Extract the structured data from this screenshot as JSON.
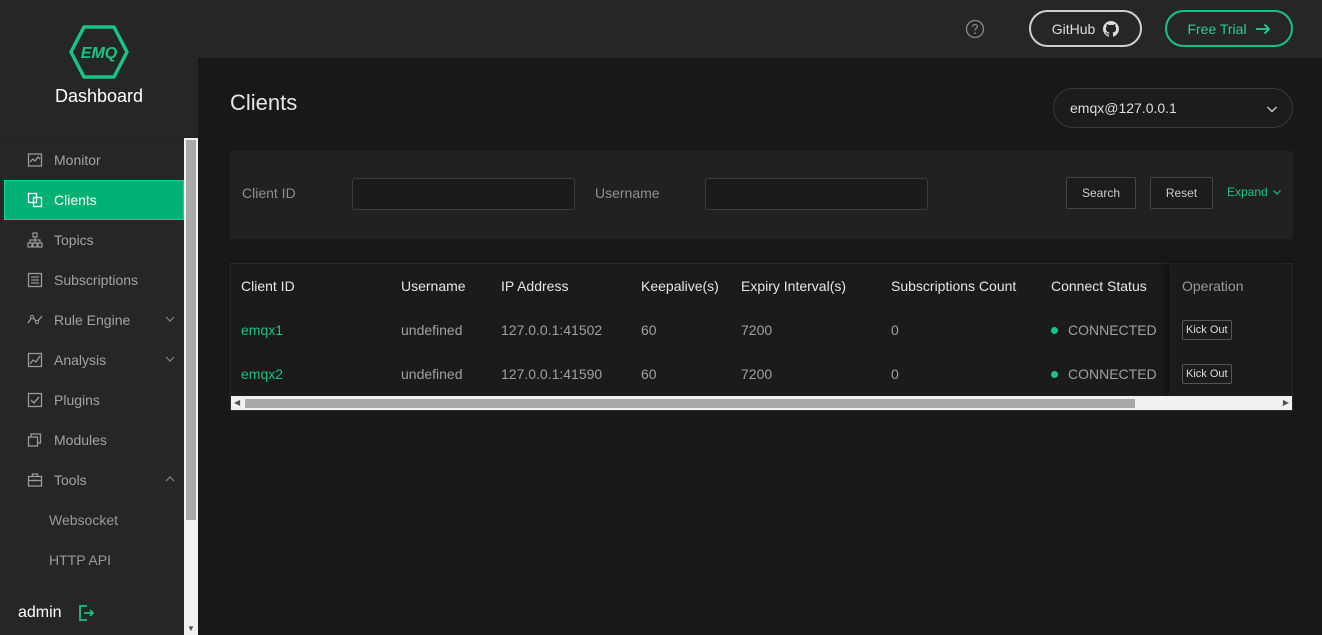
{
  "brand": {
    "logo_text": "EMQ",
    "title": "Dashboard"
  },
  "sidebar": {
    "items": [
      {
        "label": "Monitor",
        "icon": "monitor-icon"
      },
      {
        "label": "Clients",
        "icon": "clients-icon",
        "active": true
      },
      {
        "label": "Topics",
        "icon": "topics-icon"
      },
      {
        "label": "Subscriptions",
        "icon": "subscriptions-icon"
      },
      {
        "label": "Rule Engine",
        "icon": "rule-engine-icon",
        "expandable": true
      },
      {
        "label": "Analysis",
        "icon": "analysis-icon",
        "expandable": true
      },
      {
        "label": "Plugins",
        "icon": "plugins-icon"
      },
      {
        "label": "Modules",
        "icon": "modules-icon"
      },
      {
        "label": "Tools",
        "icon": "tools-icon",
        "expanded": true
      }
    ],
    "sub_items": [
      {
        "label": "Websocket"
      },
      {
        "label": "HTTP API"
      }
    ],
    "user": "admin"
  },
  "header": {
    "github_label": "GitHub",
    "trial_label": "Free Trial"
  },
  "page": {
    "title": "Clients",
    "node": "emqx@127.0.0.1"
  },
  "filter": {
    "client_id_label": "Client ID",
    "username_label": "Username",
    "client_id_value": "",
    "username_value": "",
    "search_label": "Search",
    "reset_label": "Reset",
    "expand_label": "Expand"
  },
  "table": {
    "columns": [
      "Client ID",
      "Username",
      "IP Address",
      "Keepalive(s)",
      "Expiry Interval(s)",
      "Subscriptions Count",
      "Connect Status",
      "Operation"
    ],
    "rows": [
      {
        "client_id": "emqx1",
        "username": "undefined",
        "ip": "127.0.0.1:41502",
        "keepalive": "60",
        "expiry": "7200",
        "subs": "0",
        "status": "CONNECTED",
        "op": "Kick Out"
      },
      {
        "client_id": "emqx2",
        "username": "undefined",
        "ip": "127.0.0.1:41590",
        "keepalive": "60",
        "expiry": "7200",
        "subs": "0",
        "status": "CONNECTED",
        "op": "Kick Out"
      }
    ]
  },
  "colors": {
    "accent": "#18c484",
    "sidebar_bg": "#262626",
    "page_bg": "#181818"
  }
}
